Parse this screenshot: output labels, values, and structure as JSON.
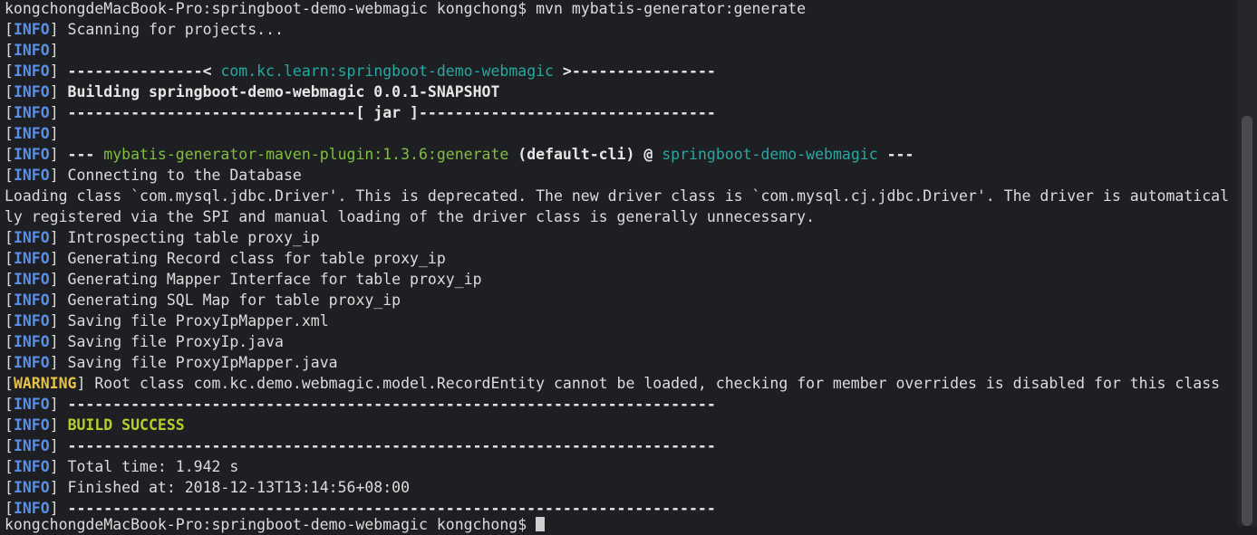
{
  "tags": {
    "info": "INFO",
    "warning": "WARNING"
  },
  "lines": {
    "l0": "kongchongdeMacBook-Pro:springboot-demo-webmagic kongchong$ mvn mybatis-generator:generate",
    "l1": " Scanning for projects...",
    "l3a": " ---------------< ",
    "l3b": "com.kc.learn:springboot-demo-webmagic",
    "l3c": " >----------------",
    "l4": " Building springboot-demo-webmagic 0.0.1-SNAPSHOT",
    "l5": " --------------------------------[ jar ]---------------------------------",
    "l7a": " --- ",
    "l7b": "mybatis-generator-maven-plugin:1.3.6:generate",
    "l7c": " (default-cli)",
    "l7d": " @ ",
    "l7e": "springboot-demo-webmagic",
    "l7f": " ---",
    "l8": " Connecting to the Database",
    "l9": "Loading class `com.mysql.jdbc.Driver'. This is deprecated. The new driver class is `com.mysql.cj.jdbc.Driver'. The driver is automatical",
    "l10": "ly registered via the SPI and manual loading of the driver class is generally unnecessary.",
    "l11": " Introspecting table proxy_ip",
    "l12": " Generating Record class for table proxy_ip",
    "l13": " Generating Mapper Interface for table proxy_ip",
    "l14": " Generating SQL Map for table proxy_ip",
    "l15": " Saving file ProxyIpMapper.xml",
    "l16": " Saving file ProxyIp.java",
    "l17": " Saving file ProxyIpMapper.java",
    "l18": " Root class com.kc.demo.webmagic.model.RecordEntity cannot be loaded, checking for member overrides is disabled for this class",
    "l19": " ------------------------------------------------------------------------",
    "l20": "BUILD SUCCESS",
    "l21": " ------------------------------------------------------------------------",
    "l22": " Total time: 1.942 s",
    "l23": " Finished at: 2018-12-13T13:14:56+08:00",
    "l24": " ------------------------------------------------------------------------",
    "l25": "kongchongdeMacBook-Pro:springboot-demo-webmagic kongchong$ "
  },
  "colors": {
    "background": "#1e1f22",
    "info_tag": "#5b8fe6",
    "warning_tag": "#e6c24b",
    "teal": "#25a9a2",
    "plugin_green": "#7fbf3f",
    "success": "#b6cf2a"
  }
}
